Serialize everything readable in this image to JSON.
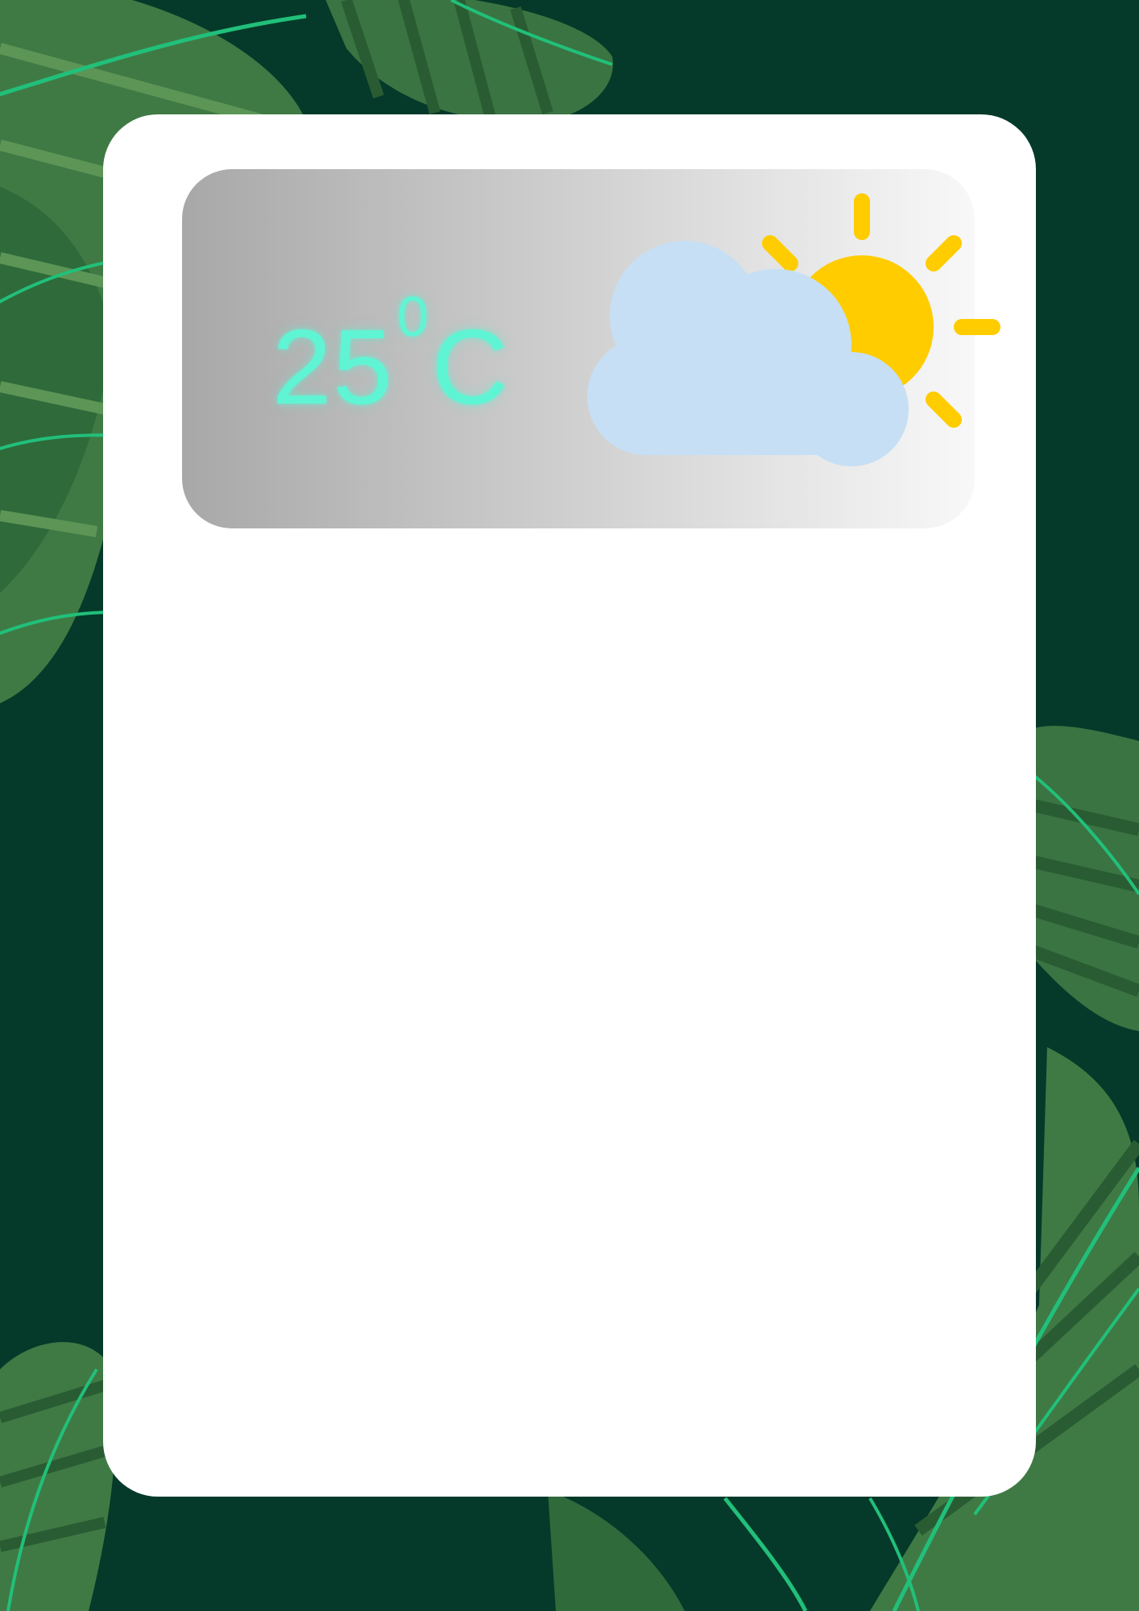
{
  "weather_widget": {
    "temperature_value": "25",
    "temperature_degree": "0",
    "temperature_unit": "C",
    "condition_icon": "partly-cloudy-icon"
  },
  "colors": {
    "background": "#053a2a",
    "card": "#ffffff",
    "temperature_text": "#5ff5d4",
    "sun": "#ffcc00",
    "cloud": "#c6dff4",
    "leaf_dark": "#2e6b3f",
    "leaf_light": "#4f8a4f",
    "leaf_vein": "#21c07a"
  }
}
